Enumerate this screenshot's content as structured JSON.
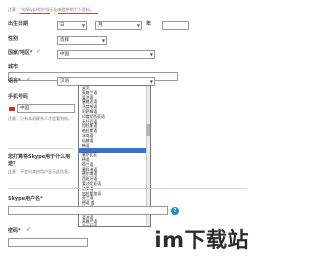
{
  "intro": {
    "text": "注意：\"向Skype用户显示出来提供的个人资料。"
  },
  "birthday": {
    "label": "出生日期",
    "day_value": "日",
    "month_value": "月",
    "year_suffix": "年"
  },
  "gender": {
    "label": "性别",
    "value": "选择"
  },
  "country": {
    "label": "国家/地区*",
    "value": "中国"
  },
  "city": {
    "label": "城市"
  },
  "language": {
    "label": "语言*",
    "value": "汉语"
  },
  "phone": {
    "label": "手机号码",
    "country_value": "中国",
    "note": "注意：只有本机联系人才会看到你。"
  },
  "language_options": [
    "英文",
    "英格兰语",
    "斐济语",
    "塞格达语",
    "马其顿语",
    "阿萨姆语",
    "印度尼西亚语",
    "无托匹语",
    "加拉斯语",
    "格拉斯语",
    "冰岛语",
    "仙赫语",
    "韩语",
    "",
    "塞尔比亚",
    "德语",
    "荷兰语",
    "塞科迪语",
    "德尔南语",
    "西班牙语",
    "爱沙尼亚语",
    "法罗语",
    "加拉斯加语",
    "芬兰语",
    "德语 盖",
    "拉丁语",
    "欧洲语",
    "斐济语",
    "苏格兰语",
    "意大利语"
  ],
  "selected_option_index": 13,
  "skype_usage": {
    "label": "您打算将Skype用于什么用途？",
    "note": "注意：不会向其他用户显示此信息。"
  },
  "skype_name": {
    "label": "Skype用户名*"
  },
  "password": {
    "label": "密码*"
  },
  "watermark": "im下载站"
}
